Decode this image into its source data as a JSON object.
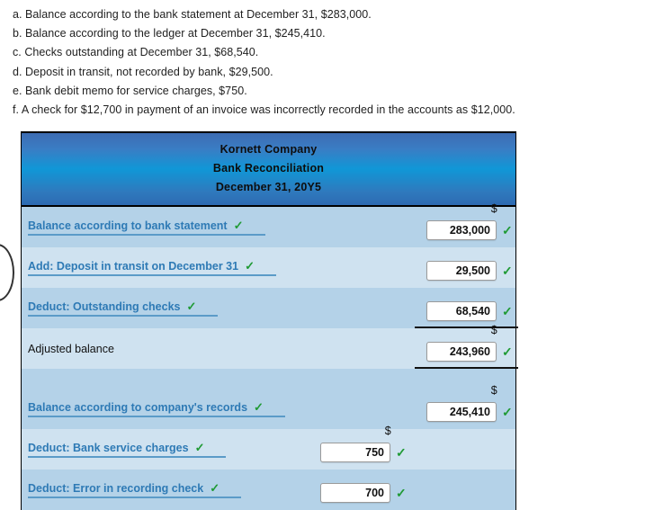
{
  "problem": {
    "lines": [
      "a. Balance according to the bank statement at December 31, $283,000.",
      "b. Balance according to the ledger at December 31, $245,410.",
      "c. Checks outstanding at December 31, $68,540.",
      "d. Deposit in transit, not recorded by bank, $29,500.",
      "e. Bank debit memo for service charges, $750.",
      "f. A check for $12,700 in payment of an invoice was incorrectly recorded in the accounts as $12,000."
    ]
  },
  "worksheet": {
    "header": {
      "company": "Kornett Company",
      "statement": "Bank Reconciliation",
      "date": "December 31, 20Y5"
    },
    "dollar_symbol": "$",
    "check_mark": "✓",
    "rows": [
      {
        "label": "Balance according to bank statement",
        "amount": "283,000",
        "column": "right",
        "label_type": "select",
        "row_shade": "dark",
        "show_dollar": true
      },
      {
        "label": "Add: Deposit in transit on December 31",
        "amount": "29,500",
        "column": "right",
        "label_type": "select",
        "row_shade": "light",
        "show_dollar": false
      },
      {
        "label": "Deduct: Outstanding checks",
        "amount": "68,540",
        "column": "right",
        "label_type": "select",
        "row_shade": "dark",
        "show_dollar": false
      },
      {
        "label": "Adjusted balance",
        "amount": "243,960",
        "column": "right",
        "label_type": "static",
        "row_shade": "light",
        "show_dollar": true
      },
      {
        "label": "Balance according to company's records",
        "amount": "245,410",
        "column": "right",
        "label_type": "select",
        "row_shade": "dark",
        "show_dollar": true
      },
      {
        "label": "Deduct: Bank service charges",
        "amount": "750",
        "column": "middle",
        "label_type": "select",
        "row_shade": "light",
        "show_dollar": true
      },
      {
        "label": "Deduct: Error in recording check",
        "amount": "700",
        "column": "middle",
        "label_type": "select",
        "row_shade": "dark",
        "show_dollar": false
      }
    ]
  }
}
